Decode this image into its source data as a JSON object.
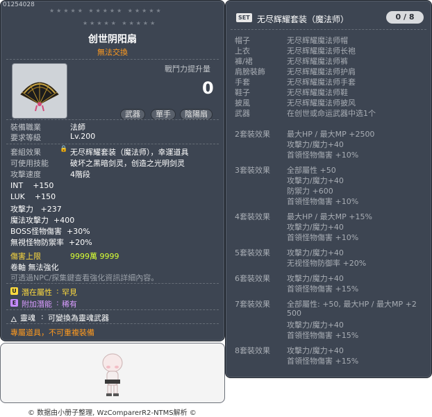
{
  "item_id": "01254028",
  "stars_row1": "★★★★★ ★★★★★ ★★★★★",
  "stars_row2": "★★★★★ ★★★★★",
  "item_name": "创世阴阳扇",
  "trade_status": "無法交換",
  "power_label": "戰鬥力提升量",
  "power_value": "0",
  "categories": [
    "武器",
    "單手",
    "陰陽扇"
  ],
  "req_job_label": "裝備職業",
  "req_job_value": "法師",
  "req_level_label": "要求等級",
  "req_level_value": "Lv.200",
  "set_effect_label": "套組效果",
  "set_effect_value_line1": "无尽辉耀套装（魔法师），幸運道具",
  "set_effect_value_line2": "破坏之黑暗剑灵，创造之光明剑灵",
  "skill_label": "可使用技能",
  "speed_label": "攻擊速度",
  "speed_value": "4階段",
  "stats": [
    {
      "label": "INT",
      "value": "+150"
    },
    {
      "label": "LUK",
      "value": "+150"
    },
    {
      "label": "攻擊力",
      "value": "+237"
    },
    {
      "label": "魔法攻擊力",
      "value": "+400"
    },
    {
      "label": "BOSS怪物傷害",
      "value": "+30%"
    },
    {
      "label": "無視怪物防禦率",
      "value": "+20%"
    }
  ],
  "damage_cap_label": "傷害上限",
  "damage_cap_value": "9999萬 9999",
  "scroll_line": "卷軸  無法強化",
  "hint_line": "可透過NPC/探集鍵查看強化資訊詳細內容。",
  "potential_label": "潛在屬性",
  "potential_value": "罕見",
  "additional_label": "附加潛能",
  "additional_value": "稀有",
  "soul_label": "靈魂",
  "soul_value": "可變換為靈魂武器",
  "exclusive_line": "專屬道具，不可重複裝備",
  "set_name": "无尽辉耀套装（魔法师）",
  "set_count": "0 / 8",
  "set_pieces": [
    {
      "slot": "帽子",
      "name": "无尽辉耀魔法师帽"
    },
    {
      "slot": "上衣",
      "name": "无尽辉耀魔法师长袍"
    },
    {
      "slot": "褲/裙",
      "name": "无尽辉耀魔法师裤"
    },
    {
      "slot": "肩膀裝飾",
      "name": "无尽辉耀魔法师护肩"
    },
    {
      "slot": "手套",
      "name": "无尽辉耀魔法师手套"
    },
    {
      "slot": "鞋子",
      "name": "无尽辉耀魔法师鞋"
    },
    {
      "slot": "披風",
      "name": "无尽辉耀魔法师披风"
    },
    {
      "slot": "武器",
      "name": "在创世或命运武器中选1个"
    }
  ],
  "set_effects": [
    {
      "label": "2套裝效果",
      "lines": [
        "最大HP / 最大MP  +2500",
        "攻擊力/魔力+40",
        "首領怪物傷害 +10%"
      ]
    },
    {
      "label": "3套裝效果",
      "lines": [
        "全部屬性 +50",
        "攻擊力/魔力+40",
        "防禦力 +600",
        "首領怪物傷害 +10%"
      ]
    },
    {
      "label": "4套裝效果",
      "lines": [
        "最大HP / 最大MP  +15%",
        "攻擊力/魔力+40",
        "首領怪物傷害 +10%"
      ]
    },
    {
      "label": "5套裝效果",
      "lines": [
        "攻擊力/魔力+40",
        "无视怪物防御率 +20%"
      ]
    },
    {
      "label": "6套裝效果",
      "lines": [
        "攻擊力/魔力+40",
        "首領怪物傷害 +15%"
      ]
    },
    {
      "label": "7套裝效果",
      "lines": [
        "全部屬性: +50, 最大HP / 最大MP  +2",
        "500",
        "攻擊力/魔力+40",
        "首領怪物傷害 +15%"
      ]
    },
    {
      "label": "8套裝效果",
      "lines": [
        "攻擊力/魔力+40",
        "首領怪物傷害 +15%"
      ]
    }
  ],
  "footer": "© 数据由小册子整理, WzComparerR2-NTMS解析 ©",
  "colors": {
    "panel_bg": "#3d4552",
    "highlight_yellow": "#fcd93f",
    "trade_orange": "#ff9a1f",
    "additional_purple": "#d99cff",
    "damage_cap_lime": "#d8ff33"
  }
}
